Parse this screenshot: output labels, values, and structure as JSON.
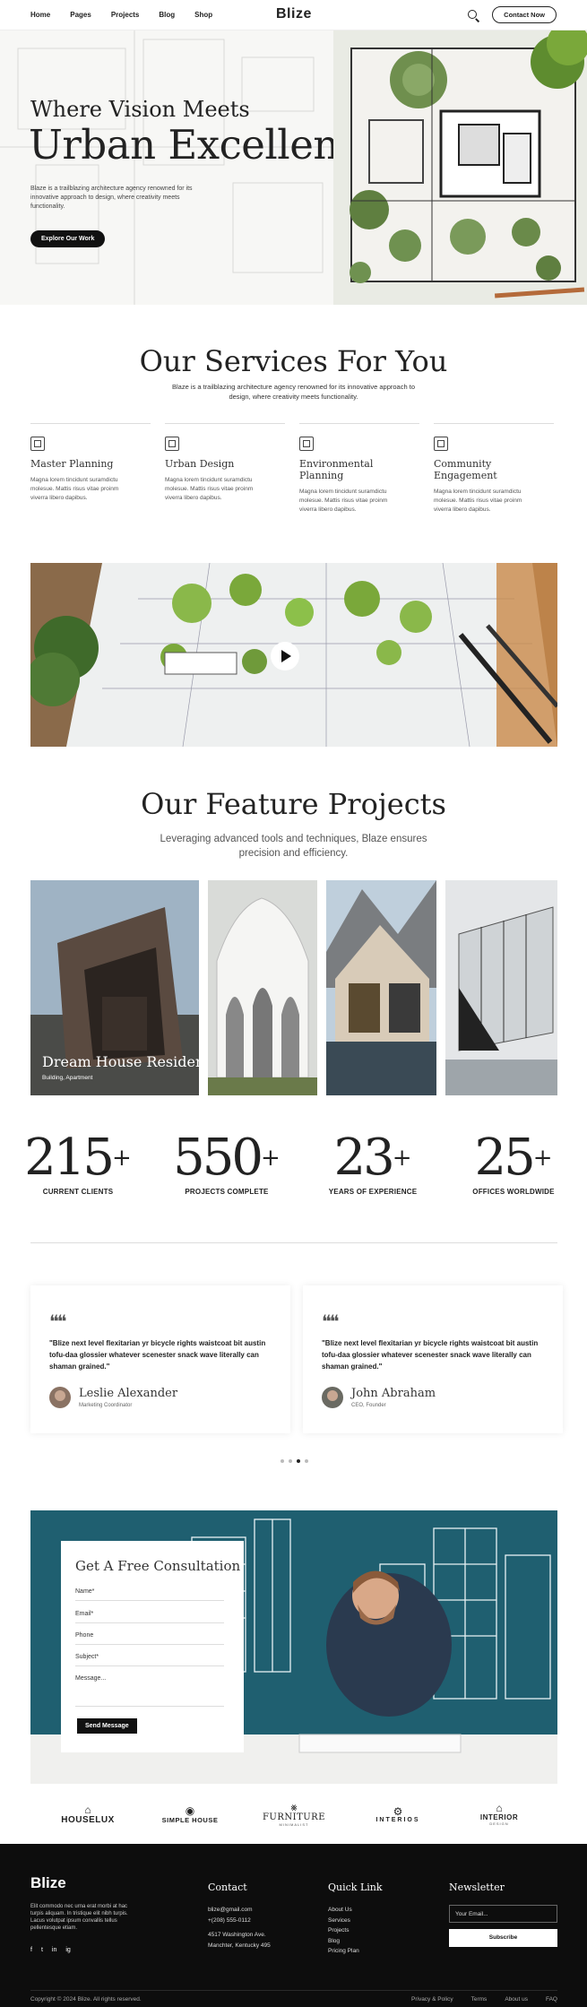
{
  "nav": {
    "links": [
      "Home",
      "Pages",
      "Projects",
      "Blog",
      "Shop"
    ],
    "logo": "Blize",
    "cta": "Contact Now"
  },
  "hero": {
    "eyebrow": "Where Vision Meets",
    "title": "Urban Excellence",
    "description": "Blaze is a trailblazing architecture agency renowned for its innovative approach to design, where creativity meets functionality.",
    "cta": "Explore Our Work"
  },
  "services": {
    "title": "Our Services For You",
    "subtitle": "Blaze is a trailblazing architecture agency renowned for its innovative approach to design, where creativity meets functionality.",
    "items": [
      {
        "title": "Master Planning",
        "desc": "Magna lorem tincidunt suramdictu molesue. Mattis risus vitae proinm viverra libero dapibus."
      },
      {
        "title": "Urban Design",
        "desc": "Magna lorem tincidunt suramdictu molesue. Mattis risus vitae proinm viverra libero dapibus."
      },
      {
        "title": "Environmental Planning",
        "desc": "Magna lorem tincidunt suramdictu molesue. Mattis risus vitae proinm viverra libero dapibus."
      },
      {
        "title": "Community Engagement",
        "desc": "Magna lorem tincidunt suramdictu molesue. Mattis risus vitae proinm viverra libero dapibus."
      }
    ]
  },
  "projects": {
    "title": "Our Feature Projects",
    "subtitle": "Leveraging advanced tools and techniques, Blaze ensures precision and efficiency.",
    "featured_name": "Dream House Residential",
    "featured_tags": "Building, Apartment"
  },
  "stats": [
    {
      "value": "215",
      "suffix": "+",
      "label": "CURRENT CLIENTS"
    },
    {
      "value": "550",
      "suffix": "+",
      "label": "PROJECTS COMPLETE"
    },
    {
      "value": "23",
      "suffix": "+",
      "label": "YEARS OF EXPERIENCE"
    },
    {
      "value": "25",
      "suffix": "+",
      "label": "OFFICES WORLDWIDE"
    }
  ],
  "testimonials": [
    {
      "quote": "\"Blize next level flexitarian yr bicycle rights waistcoat bit austin tofu-daa glossier whatever scenester snack wave literally can shaman grained.\"",
      "name": "Leslie Alexander",
      "role": "Marketing Coordinator"
    },
    {
      "quote": "\"Blize next level flexitarian yr bicycle rights waistcoat bit austin tofu-daa glossier whatever scenester snack wave literally can shaman grained.\"",
      "name": "John Abraham",
      "role": "CEO, Founder"
    }
  ],
  "consultation": {
    "title": "Get A Free Consultation",
    "fields": [
      "Name*",
      "Email*",
      "Phone",
      "Subject*",
      "Message..."
    ],
    "submit": "Send Message"
  },
  "brands": [
    {
      "name": "HOUSELUX",
      "icon": "house-icon"
    },
    {
      "name": "SIMPLE HOUSE",
      "icon": "circle-house-icon"
    },
    {
      "name": "FURNITURE",
      "tag": "MINIMALIST",
      "icon": "lamp-icon"
    },
    {
      "name": "INTERIOS",
      "icon": "gear-badge-icon"
    },
    {
      "name": "INTERIOR",
      "tag": "DESIGN",
      "icon": "house-outline-icon"
    }
  ],
  "footer": {
    "logo": "Blize",
    "description": "Elit commodo nec urna erat morbi at hac turpis aliquam. In tristique elit nibh turpis. Lacus volutpat ipsum convallis tellus pellentesque etiam.",
    "social": [
      "f",
      "t",
      "in",
      "ig"
    ],
    "contact_title": "Contact",
    "contact_lines": [
      "blize@gmail.com",
      "+(208) 555-0112",
      "",
      "4517 Washington Ave.",
      "Manchter, Kentucky 495"
    ],
    "quick_title": "Quick Link",
    "quick_links": [
      "About Us",
      "Services",
      "Projects",
      "Blog",
      "Pricing Plan"
    ],
    "newsletter_title": "Newsletter",
    "newsletter_placeholder": "Your Email...",
    "newsletter_button": "Subscribe",
    "copyright": "Copyright © 2024 Blize. All rights reserved.",
    "legal_links": [
      "Privacy & Policy",
      "Terms",
      "About us",
      "FAQ"
    ]
  }
}
